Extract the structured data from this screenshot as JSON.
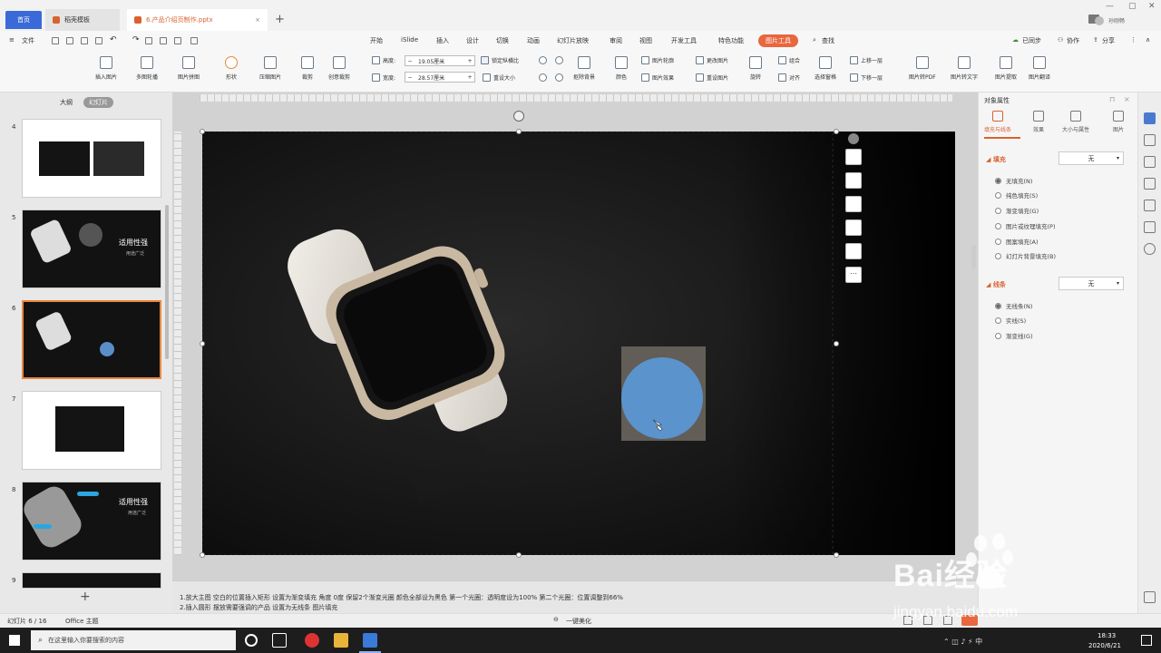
{
  "tabs": {
    "home": "首页",
    "template": "稻壳模板",
    "file": "6.产品介绍页制作.pptx"
  },
  "menu": {
    "file": "文件",
    "items": [
      "开始",
      "iSlide",
      "插入",
      "设计",
      "切换",
      "动画",
      "幻灯片放映",
      "审阅",
      "视图",
      "开发工具",
      "特色功能"
    ],
    "active": "图片工具",
    "search": "查找",
    "sync": "已同步",
    "collab": "协作",
    "share": "分享"
  },
  "ribbon": {
    "insert_pic": "插入图片",
    "multi_pic": "多图轮播",
    "pic_collage": "图片拼图",
    "shape": "形状",
    "compress": "压缩图片",
    "crop": "裁剪",
    "creative_crop": "创意裁剪",
    "height_label": "高度:",
    "height_value": "19.05厘米",
    "width_label": "宽度:",
    "width_value": "28.57厘米",
    "lock_ratio": "锁定纵横比",
    "reset_size": "重设大小",
    "remove_bg": "抠除背景",
    "color": "颜色",
    "pic_outline": "图片轮廓",
    "pic_effect": "图片效果",
    "change_pic": "更改图片",
    "reset_pic": "重设图片",
    "rotate": "旋转",
    "group": "组合",
    "align": "对齐",
    "select_pane": "选择窗格",
    "bring_forward": "上移一层",
    "send_backward": "下移一层",
    "to_pdf": "图片转PDF",
    "to_text": "图片转文字",
    "extract": "图片提取",
    "translate": "图片翻译"
  },
  "left_panel": {
    "tab_outline": "大纲",
    "tab_slides": "幻灯片",
    "slide_numbers": [
      "4",
      "5",
      "6",
      "7",
      "8",
      "9"
    ],
    "thumb5_title": "适用性强",
    "thumb5_sub": "用途广泛",
    "thumb8_title": "适用性强",
    "thumb8_sub": "用途广泛"
  },
  "right_panel": {
    "title": "对象属性",
    "tabs": [
      "填充与线条",
      "效果",
      "大小与属性",
      "图片"
    ],
    "fill_section": "填充",
    "fill_value": "无",
    "fill_options": [
      "无填充(N)",
      "纯色填充(S)",
      "渐变填充(G)",
      "图片或纹理填充(P)",
      "图案填充(A)",
      "幻灯片背景填充(B)"
    ],
    "line_section": "线条",
    "line_value": "无",
    "line_options": [
      "无线条(N)",
      "实线(S)",
      "渐变线(G)"
    ]
  },
  "notes": {
    "line1": "1.放大主图 空白的位置插入矩形 设置为渐变填充 角度 0度 保留2个渐变光圈 颜色全部设为黑色 第一个光圈：透明度设为100% 第二个光圈：位置调整到66%",
    "line2": "2.插入圆形 摆放需要强调的产品 设置为无线条 图片填充"
  },
  "status": {
    "slide_pos": "幻灯片 6 / 16",
    "theme": "Office 主题",
    "beautify": "一键美化"
  },
  "taskbar": {
    "search_placeholder": "在这里输入你要搜索的内容",
    "time": "18:33",
    "date": "2020/6/21"
  },
  "watermark": {
    "brand": "Bai经验",
    "url": "jingyan.baidu.com"
  },
  "user": "孙刚畅"
}
